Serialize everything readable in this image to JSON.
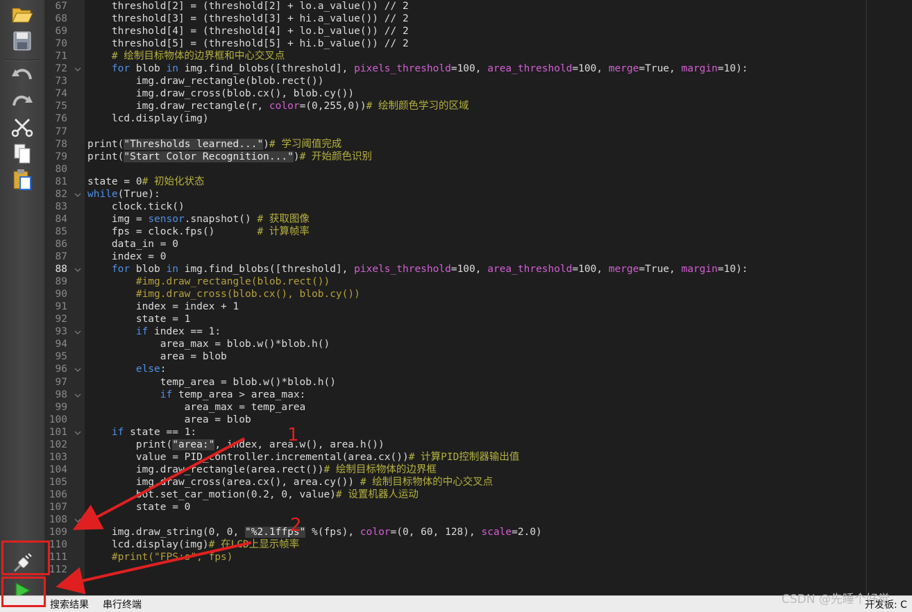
{
  "toolbar": {
    "icons": [
      "folder-open-icon",
      "save-icon",
      "undo-icon",
      "redo-icon",
      "cut-icon",
      "copy-icon",
      "paste-icon",
      "connect-icon",
      "run-icon"
    ]
  },
  "editor": {
    "current_line": "88",
    "lines": [
      {
        "n": "67",
        "fold": false
      },
      {
        "n": "68",
        "fold": false
      },
      {
        "n": "69",
        "fold": false
      },
      {
        "n": "70",
        "fold": false
      },
      {
        "n": "71",
        "fold": false
      },
      {
        "n": "72",
        "fold": true
      },
      {
        "n": "73",
        "fold": false
      },
      {
        "n": "74",
        "fold": false
      },
      {
        "n": "75",
        "fold": false
      },
      {
        "n": "76",
        "fold": false
      },
      {
        "n": "77",
        "fold": false
      },
      {
        "n": "78",
        "fold": false
      },
      {
        "n": "79",
        "fold": false
      },
      {
        "n": "80",
        "fold": false
      },
      {
        "n": "81",
        "fold": false
      },
      {
        "n": "82",
        "fold": true
      },
      {
        "n": "83",
        "fold": false
      },
      {
        "n": "84",
        "fold": false
      },
      {
        "n": "85",
        "fold": false
      },
      {
        "n": "86",
        "fold": false
      },
      {
        "n": "87",
        "fold": false
      },
      {
        "n": "88",
        "fold": true
      },
      {
        "n": "89",
        "fold": false
      },
      {
        "n": "90",
        "fold": false
      },
      {
        "n": "91",
        "fold": false
      },
      {
        "n": "92",
        "fold": false
      },
      {
        "n": "93",
        "fold": true
      },
      {
        "n": "94",
        "fold": false
      },
      {
        "n": "95",
        "fold": false
      },
      {
        "n": "96",
        "fold": true
      },
      {
        "n": "97",
        "fold": false
      },
      {
        "n": "98",
        "fold": true
      },
      {
        "n": "99",
        "fold": false
      },
      {
        "n": "100",
        "fold": false
      },
      {
        "n": "101",
        "fold": true
      },
      {
        "n": "102",
        "fold": false
      },
      {
        "n": "103",
        "fold": false
      },
      {
        "n": "104",
        "fold": false
      },
      {
        "n": "105",
        "fold": false
      },
      {
        "n": "106",
        "fold": false
      },
      {
        "n": "107",
        "fold": false
      },
      {
        "n": "108",
        "fold": true
      },
      {
        "n": "109",
        "fold": false
      },
      {
        "n": "110",
        "fold": false
      },
      {
        "n": "111",
        "fold": false
      },
      {
        "n": "112",
        "fold": false
      }
    ],
    "code": [
      [
        [
          "    threshold[2] = (threshold[2] + lo.a_value()) // 2",
          ""
        ]
      ],
      [
        [
          "    threshold[3] = (threshold[3] + hi.a_value()) // 2",
          ""
        ]
      ],
      [
        [
          "    threshold[4] = (threshold[4] + lo.b_value()) // 2",
          ""
        ]
      ],
      [
        [
          "    threshold[5] = (threshold[5] + hi.b_value()) // 2",
          ""
        ]
      ],
      [
        [
          "    ",
          ""
        ],
        [
          "# 绘制目标物体的边界框和中心交叉点",
          "cm"
        ]
      ],
      [
        [
          "    ",
          ""
        ],
        [
          "for",
          "kw"
        ],
        [
          " blob ",
          ""
        ],
        [
          "in",
          "kw"
        ],
        [
          " img.find_blobs([threshold], ",
          ""
        ],
        [
          "pixels_threshold",
          "param"
        ],
        [
          "=100, ",
          ""
        ],
        [
          "area_threshold",
          "param"
        ],
        [
          "=100, ",
          ""
        ],
        [
          "merge",
          "param"
        ],
        [
          "=True, ",
          ""
        ],
        [
          "margin",
          "param"
        ],
        [
          "=10):",
          ""
        ]
      ],
      [
        [
          "        img.draw_rectangle(blob.rect())",
          ""
        ]
      ],
      [
        [
          "        img.draw_cross(blob.cx(), blob.cy())",
          ""
        ]
      ],
      [
        [
          "        img.draw_rectangle(r, ",
          ""
        ],
        [
          "color",
          "param"
        ],
        [
          "=(0,255,0))",
          ""
        ],
        [
          "# 绘制颜色学习的区域",
          "cm"
        ]
      ],
      [
        [
          "    lcd.display(img)",
          ""
        ]
      ],
      [
        [
          "",
          ""
        ]
      ],
      [
        [
          "print(",
          ""
        ],
        [
          "\"Thresholds learned...\"",
          "str"
        ],
        [
          ")",
          ""
        ],
        [
          "# 学习阈值完成",
          "cm"
        ]
      ],
      [
        [
          "print(",
          ""
        ],
        [
          "\"Start Color Recognition...\"",
          "str"
        ],
        [
          ")",
          ""
        ],
        [
          "# 开始颜色识别",
          "cm"
        ]
      ],
      [
        [
          "",
          ""
        ]
      ],
      [
        [
          "state = 0",
          ""
        ],
        [
          "# 初始化状态",
          "cm"
        ]
      ],
      [
        [
          "while",
          "kw"
        ],
        [
          "(True):",
          ""
        ]
      ],
      [
        [
          "    clock.tick()",
          ""
        ]
      ],
      [
        [
          "    img = ",
          ""
        ],
        [
          "sensor",
          "kw"
        ],
        [
          ".snapshot() ",
          ""
        ],
        [
          "# 获取图像",
          "cm"
        ]
      ],
      [
        [
          "    fps = clock.fps()       ",
          ""
        ],
        [
          "# 计算帧率",
          "cm"
        ]
      ],
      [
        [
          "    data_in = 0",
          ""
        ]
      ],
      [
        [
          "    index = 0",
          ""
        ]
      ],
      [
        [
          "    ",
          ""
        ],
        [
          "for",
          "kw"
        ],
        [
          " blob ",
          ""
        ],
        [
          "in",
          "kw"
        ],
        [
          " img.find_blobs([threshold], ",
          ""
        ],
        [
          "pixels_threshold",
          "param"
        ],
        [
          "=100, ",
          ""
        ],
        [
          "area_threshold",
          "param"
        ],
        [
          "=100, ",
          ""
        ],
        [
          "merge",
          "param"
        ],
        [
          "=True, ",
          ""
        ],
        [
          "margin",
          "param"
        ],
        [
          "=10):",
          ""
        ]
      ],
      [
        [
          "        ",
          ""
        ],
        [
          "#img.draw_rectangle(blob.rect())",
          "cmt-code"
        ]
      ],
      [
        [
          "        ",
          ""
        ],
        [
          "#img.draw_cross(blob.cx(), blob.cy())",
          "cmt-code"
        ]
      ],
      [
        [
          "        index = index + 1",
          ""
        ]
      ],
      [
        [
          "        state = 1",
          ""
        ]
      ],
      [
        [
          "        ",
          ""
        ],
        [
          "if",
          "kw"
        ],
        [
          " index == 1:",
          ""
        ]
      ],
      [
        [
          "            area_max = blob.w()*blob.h()",
          ""
        ]
      ],
      [
        [
          "            area = blob",
          ""
        ]
      ],
      [
        [
          "        ",
          ""
        ],
        [
          "else",
          "kw"
        ],
        [
          ":",
          ""
        ]
      ],
      [
        [
          "            temp_area = blob.w()*blob.h()",
          ""
        ]
      ],
      [
        [
          "            ",
          ""
        ],
        [
          "if",
          "kw"
        ],
        [
          " temp_area > area_max:",
          ""
        ]
      ],
      [
        [
          "                area_max = temp_area",
          ""
        ]
      ],
      [
        [
          "                area = blob",
          ""
        ]
      ],
      [
        [
          "    ",
          ""
        ],
        [
          "if",
          "kw"
        ],
        [
          " state == 1:",
          ""
        ]
      ],
      [
        [
          "        print(",
          ""
        ],
        [
          "\"area:\"",
          "str"
        ],
        [
          ", index, area.w(), area.h())",
          ""
        ]
      ],
      [
        [
          "        value = PID_controller.incremental(area.cx())",
          ""
        ],
        [
          "# 计算PID控制器输出值",
          "cm"
        ]
      ],
      [
        [
          "        img.draw_rectangle(area.rect())",
          ""
        ],
        [
          "# 绘制目标物体的边界框",
          "cm"
        ]
      ],
      [
        [
          "        img.draw_cross(area.cx(), area.cy()) ",
          ""
        ],
        [
          "# 绘制目标物体的中心交叉点",
          "cm"
        ]
      ],
      [
        [
          "        bot.set_car_motion(0.2, 0, value)",
          ""
        ],
        [
          "# 设置机器人运动",
          "cm"
        ]
      ],
      [
        [
          "        state = 0",
          ""
        ]
      ],
      [
        [
          "",
          ""
        ]
      ],
      [
        [
          "    img.draw_string(0, 0, ",
          ""
        ],
        [
          "\"%2.1ffps\"",
          "str"
        ],
        [
          " %(fps), ",
          ""
        ],
        [
          "color",
          "param"
        ],
        [
          "=(0, 60, 128), ",
          ""
        ],
        [
          "scale",
          "param"
        ],
        [
          "=2.0)",
          ""
        ]
      ],
      [
        [
          "    lcd.display(img)",
          ""
        ],
        [
          "# 在LCD上显示帧率",
          "cm"
        ]
      ],
      [
        [
          "    ",
          ""
        ],
        [
          "#print(\"FPS:s\", fps)",
          "cmt-code"
        ]
      ],
      [
        [
          "",
          ""
        ]
      ]
    ]
  },
  "statusbar": {
    "tab_search": "搜索结果",
    "tab_serial": "串行终端",
    "devboard": "开发板: C"
  },
  "watermark": "CSDN @先睡个好觉",
  "annotations": {
    "label_1": "1",
    "label_2": "2",
    "color": "#e02020"
  }
}
